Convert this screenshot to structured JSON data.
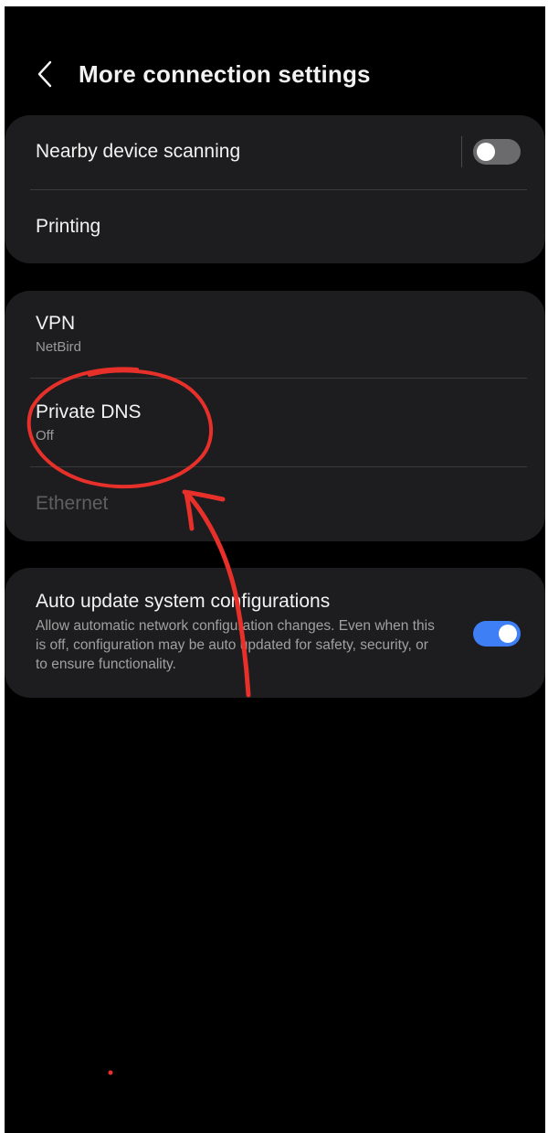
{
  "header": {
    "title": "More connection settings"
  },
  "group1": {
    "nearby": {
      "label": "Nearby device scanning",
      "toggle_state": "off"
    },
    "printing": {
      "label": "Printing"
    }
  },
  "group2": {
    "vpn": {
      "label": "VPN",
      "value": "NetBird"
    },
    "private_dns": {
      "label": "Private DNS",
      "value": "Off"
    },
    "ethernet": {
      "label": "Ethernet"
    }
  },
  "group3": {
    "auto_update": {
      "label": "Auto update system configurations",
      "description": "Allow automatic network configuration changes. Even when this is off, configuration may be auto updated for safety, security, or to ensure functionality.",
      "toggle_state": "on"
    }
  },
  "colors": {
    "toggle_on": "#3e7ff6",
    "annotation": "#e8302a",
    "card_bg": "#1d1d1f"
  }
}
